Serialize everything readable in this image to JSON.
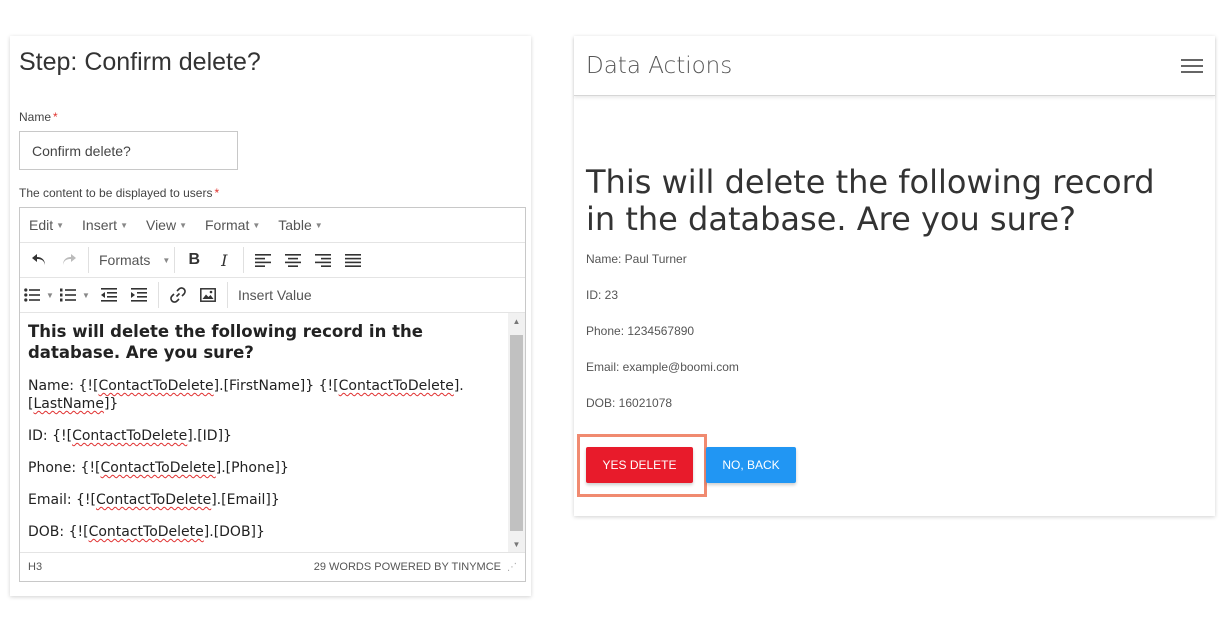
{
  "step": {
    "title": "Step: Confirm delete?",
    "name_label": "Name",
    "name_value": "Confirm delete?",
    "content_label": "The content to be displayed to users",
    "required_mark": "*"
  },
  "editor": {
    "menu": [
      "Edit",
      "Insert",
      "View",
      "Format",
      "Table"
    ],
    "toolbar": {
      "formats_label": "Formats",
      "insert_value_label": "Insert Value"
    },
    "content": {
      "heading": "This will delete the following record in the database. Are you sure?",
      "name_prefix": "Name: {![",
      "name_token1": "ContactToDelete",
      "name_mid": "].[FirstName]} {![",
      "name_token2": "ContactToDelete",
      "name_mid2": "].[",
      "name_token3": "LastName",
      "name_suffix": "]}",
      "id_prefix": "ID: {![",
      "id_token": "ContactToDelete",
      "id_suffix": "].[ID]}",
      "phone_prefix": "Phone: {![",
      "phone_token": "ContactToDelete",
      "phone_suffix": "].[Phone]}",
      "email_prefix": "Email: {![",
      "email_token": "ContactToDelete",
      "email_suffix": "].[Email]}",
      "dob_prefix": "DOB: {![",
      "dob_token": "ContactToDelete",
      "dob_suffix": "].[DOB]}"
    },
    "status": {
      "path": "H3",
      "wordcount": "29 WORDS POWERED BY TINYMCE"
    }
  },
  "preview": {
    "title": "Data Actions",
    "heading": "This will delete the following record in the database. Are you sure?",
    "lines": [
      "Name: Paul Turner",
      "ID: 23",
      "Phone: 1234567890",
      "Email: example@boomi.com",
      "DOB: 16021078"
    ],
    "yes_button": "YES DELETE",
    "no_button": "NO, BACK",
    "colors": {
      "yes": "#e81b2b",
      "no": "#2196f3",
      "highlight": "#f08a70"
    }
  }
}
